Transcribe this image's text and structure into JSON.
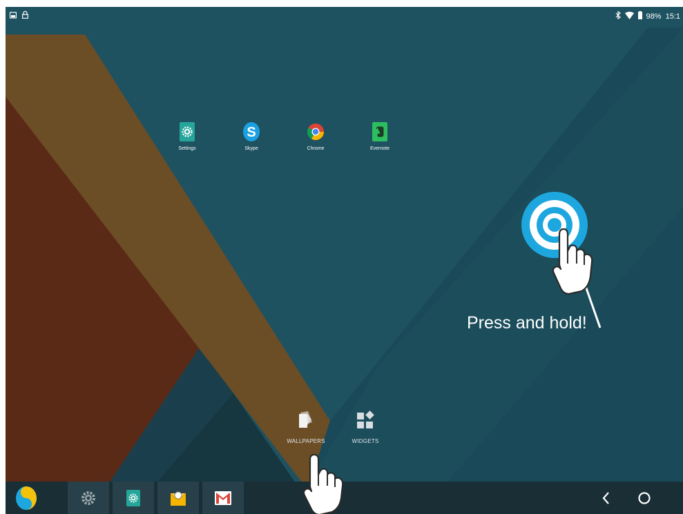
{
  "status_bar": {
    "battery_text": "98%",
    "time": "15:1",
    "left_icons": [
      "screenshot-icon",
      "lock-icon"
    ],
    "right_icons": [
      "bluetooth-icon",
      "wifi-icon",
      "battery-icon"
    ]
  },
  "desktop": {
    "apps": [
      {
        "label": "Settings",
        "icon": "settings-icon"
      },
      {
        "label": "Skype",
        "icon": "skype-icon"
      },
      {
        "label": "Chrome",
        "icon": "chrome-icon"
      },
      {
        "label": "Evernote",
        "icon": "evernote-icon"
      }
    ]
  },
  "overview": {
    "wallpapers_label": "WALLPAPERS",
    "widgets_label": "WIDGETS"
  },
  "hint": {
    "text": "Press and hold!"
  },
  "taskbar": {
    "items": [
      "start-menu-icon",
      "settings-gear-icon",
      "settings-icon",
      "email-icon",
      "gmail-icon"
    ],
    "nav": [
      "back-icon",
      "home-icon"
    ]
  },
  "colors": {
    "background": "#1e5261",
    "band_gold": "#6b4d26",
    "band_rust": "#5a2a16",
    "accent_cyan": "#1ea7df",
    "taskbar": "#1a2e36"
  }
}
